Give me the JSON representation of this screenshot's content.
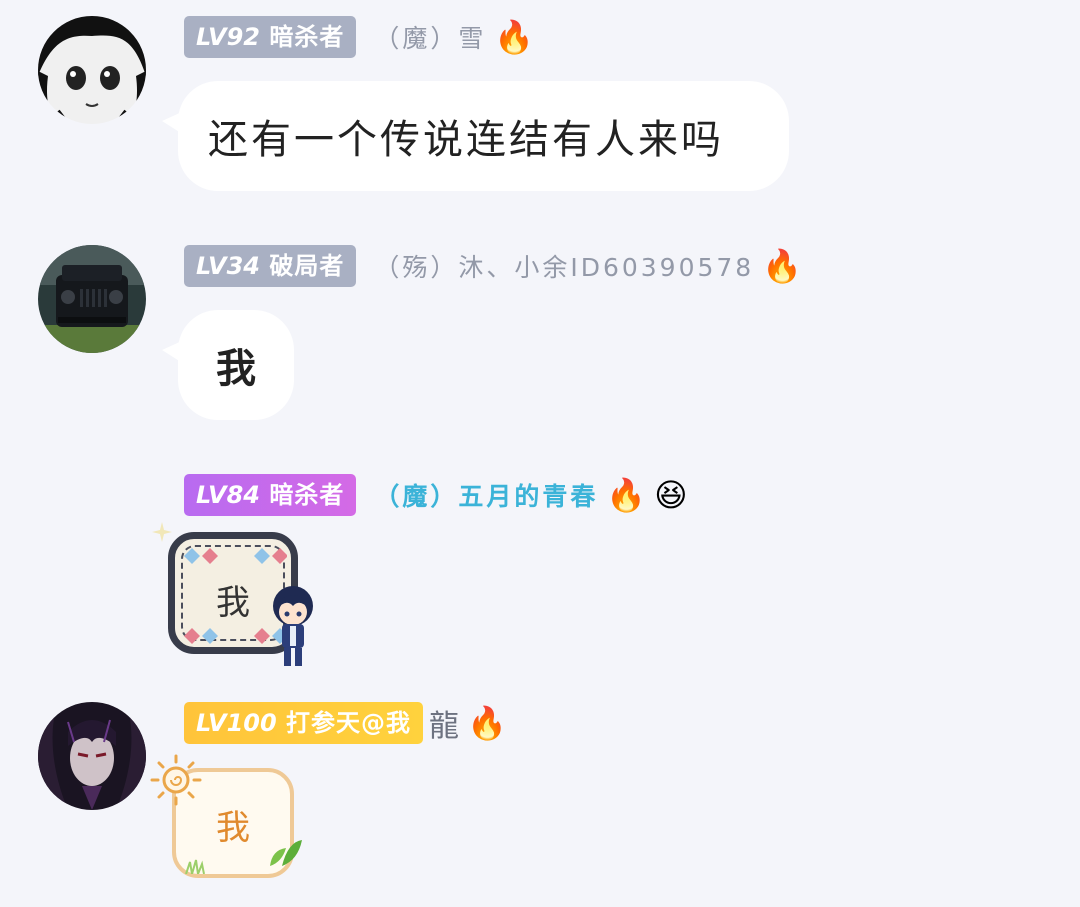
{
  "messages": [
    {
      "level": "LV92",
      "title": "暗杀者",
      "nickname": "（魔）雪",
      "emoji": "🔥",
      "text": "还有一个传说连结有人来吗"
    },
    {
      "level": "LV34",
      "title": "破局者",
      "nickname": "（殇）沐、小余ID60390578",
      "emoji": "🔥",
      "text": "我"
    },
    {
      "level": "LV84",
      "title": "暗杀者",
      "nickname": "（魔）五月的青春",
      "emoji": "🔥",
      "emoji2": "😆",
      "text": "我"
    },
    {
      "level": "LV100",
      "title": "打参天@我",
      "nickname": "龍",
      "emoji": "🔥",
      "text": "我"
    }
  ],
  "colors": {
    "background": "#f4f5fa",
    "badge_gray": "#a9b0c3",
    "badge_purple": "#c06cec",
    "badge_yellow": "#ffc93a",
    "nick_cyan": "#3bb3d8"
  }
}
